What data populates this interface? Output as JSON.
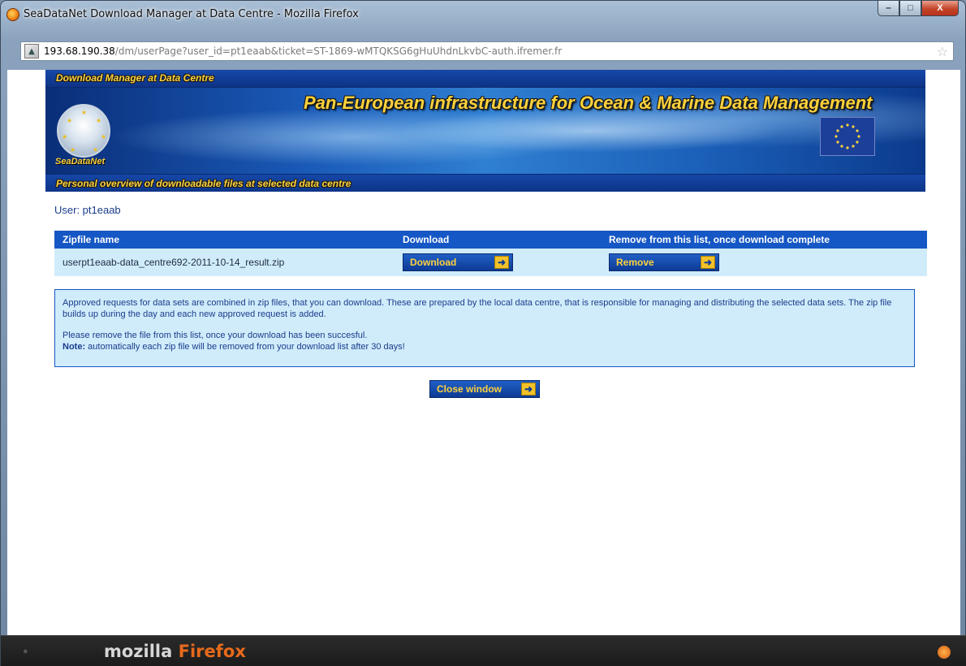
{
  "window": {
    "title": "SeaDataNet Download Manager at Data Centre - Mozilla Firefox",
    "buttons": {
      "minimize": "‒",
      "maximize": "□",
      "close": "X"
    }
  },
  "address_bar": {
    "domain": "193.68.190.38",
    "path": "/dm/userPage?user_id=pt1eaab&ticket=ST-1869-wMTQKSG6gHuUhdnLkvbC-auth.ifremer.fr"
  },
  "banner": {
    "top_label": "Download Manager at Data Centre",
    "headline": "Pan-European infrastructure for Ocean & Marine Data Management",
    "logo_name": "SeaDataNet",
    "bottom_label": "Personal overview of downloadable files at selected data centre"
  },
  "user": {
    "label": "User: pt1eaab"
  },
  "table": {
    "headers": [
      "Zipfile name",
      "Download",
      "Remove from this list, once download complete"
    ],
    "rows": [
      {
        "filename": "userpt1eaab-data_centre692-2011-10-14_result.zip",
        "download_label": "Download",
        "remove_label": "Remove"
      }
    ]
  },
  "info": {
    "paragraph1": "Approved requests for data sets are combined in zip files, that you can download. These are prepared by the local data centre, that is responsible for managing and distributing the selected data sets. The zip file builds up during the day and each new approved request is added.",
    "paragraph2": "Please remove the file from this list, once your download has been succesful.",
    "note_label": "Note:",
    "note_text": " automatically each zip file will be removed from your download list after 30 days!"
  },
  "close_button": {
    "label": "Close window"
  },
  "browser_footer": {
    "brand_mozilla": "mozilla",
    "brand_firefox": "Firefox"
  },
  "colors": {
    "table_header": "#1557c4",
    "row_bg": "#d0ecfa",
    "button_text": "#ffd23c",
    "banner_text": "#ffd23c"
  },
  "icons": {
    "arrow": "arrow-right-icon",
    "bookmark": "star-icon",
    "eu_flag": "eu-flag-icon"
  }
}
